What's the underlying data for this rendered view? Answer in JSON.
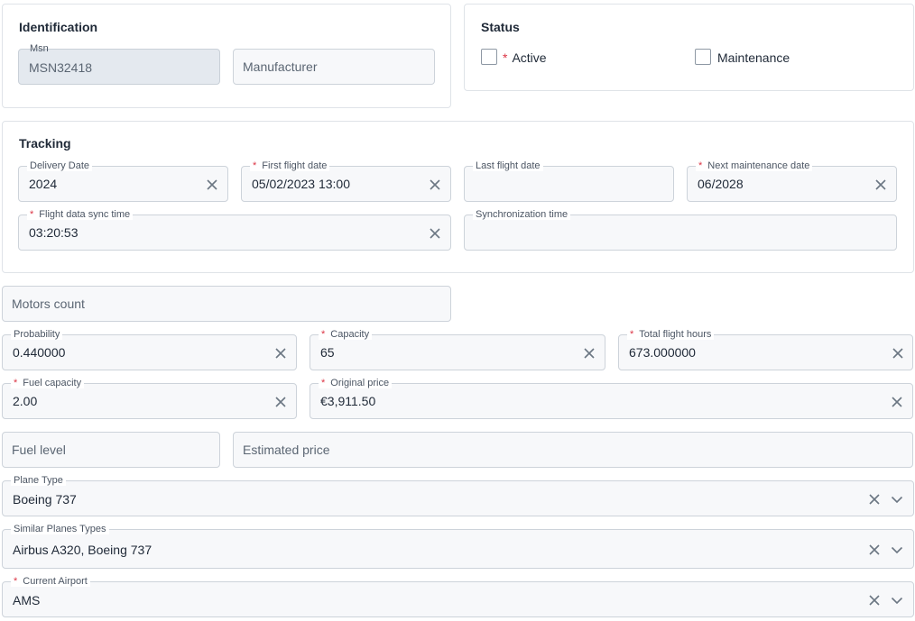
{
  "identification": {
    "title": "Identification",
    "msn": {
      "label": "Msn",
      "value": "MSN32418"
    },
    "manufacturer": {
      "placeholder": "Manufacturer"
    }
  },
  "status": {
    "title": "Status",
    "active": {
      "label": "Active",
      "required": "*",
      "checked": false
    },
    "maintenance": {
      "label": "Maintenance",
      "checked": false
    }
  },
  "tracking": {
    "title": "Tracking",
    "delivery_date": {
      "label": "Delivery Date",
      "value": "2024"
    },
    "first_flight_date": {
      "label": "First flight date",
      "value": "05/02/2023 13:00",
      "required": "*"
    },
    "last_flight_date": {
      "label": "Last flight date",
      "value": ""
    },
    "next_maintenance_date": {
      "label": "Next maintenance date",
      "value": "06/2028",
      "required": "*"
    },
    "flight_data_sync_time": {
      "label": "Flight data sync time",
      "value": "03:20:53",
      "required": "*"
    },
    "synchronization_time": {
      "label": "Synchronization time",
      "value": ""
    }
  },
  "motors_count": {
    "placeholder": "Motors count"
  },
  "probability": {
    "label": "Probability",
    "value": "0.440000"
  },
  "capacity": {
    "label": "Capacity",
    "value": "65",
    "required": "*"
  },
  "total_flight_hours": {
    "label": "Total flight hours",
    "value": "673.000000",
    "required": "*"
  },
  "fuel_capacity": {
    "label": "Fuel capacity",
    "value": "2.00",
    "required": "*"
  },
  "original_price": {
    "label": "Original price",
    "value": "€3,911.50",
    "required": "*"
  },
  "fuel_level": {
    "placeholder": "Fuel level"
  },
  "estimated_price": {
    "placeholder": "Estimated price"
  },
  "plane_type": {
    "label": "Plane Type",
    "value": "Boeing 737"
  },
  "similar_planes_types": {
    "label": "Similar Planes Types",
    "value": "Airbus A320, Boeing 737"
  },
  "current_airport": {
    "label": "Current Airport",
    "value": "AMS",
    "required": "*"
  },
  "icons": {
    "clear": "close-icon",
    "dropdown": "chevron-down-icon"
  },
  "colors": {
    "required": "#dc3545",
    "field_bg": "#f7f8fa",
    "border": "#cdd3da",
    "disabled_bg": "#e4e9ef"
  }
}
